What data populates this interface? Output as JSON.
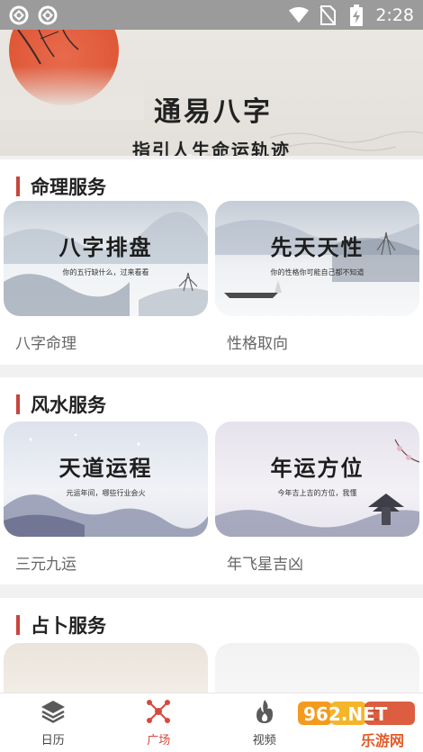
{
  "status_bar": {
    "time": "2:28",
    "icons": [
      "app-notification-icon",
      "app-notification-icon",
      "wifi-icon",
      "no-sim-icon",
      "battery-charging-icon"
    ]
  },
  "banner": {
    "title": "通易八字",
    "subtitle": "指引人生命运轨迹",
    "dots": 3,
    "active_dot": 0
  },
  "sections": [
    {
      "title": "命理服务",
      "cards": [
        {
          "title": "八字排盘",
          "subtitle": "你的五行缺什么，过来看看",
          "label": "八字命理"
        },
        {
          "title": "先天天性",
          "subtitle": "你的性格你可能自己都不知道",
          "label": "性格取向"
        }
      ]
    },
    {
      "title": "风水服务",
      "cards": [
        {
          "title": "天道运程",
          "subtitle": "元运年间，哪些行业会火",
          "label": "三元九运"
        },
        {
          "title": "年运方位",
          "subtitle": "今年吉上吉的方位，我懂",
          "label": "年飞星吉凶"
        }
      ]
    },
    {
      "title": "占卜服务",
      "cards": []
    }
  ],
  "bottom_nav": {
    "items": [
      {
        "label": "日历",
        "icon": "layers-icon",
        "active": false
      },
      {
        "label": "广场",
        "icon": "network-nodes-icon",
        "active": true
      },
      {
        "label": "视频",
        "icon": "flame-icon",
        "active": false
      },
      {
        "label": "",
        "icon": "profile-icon",
        "active": false
      }
    ]
  },
  "watermark": {
    "brand": "962.NET",
    "tagline": "乐游网"
  },
  "colors": {
    "accent": "#c8453c",
    "nav_active": "#d7493c",
    "status_bar": "#9b9b9b"
  }
}
